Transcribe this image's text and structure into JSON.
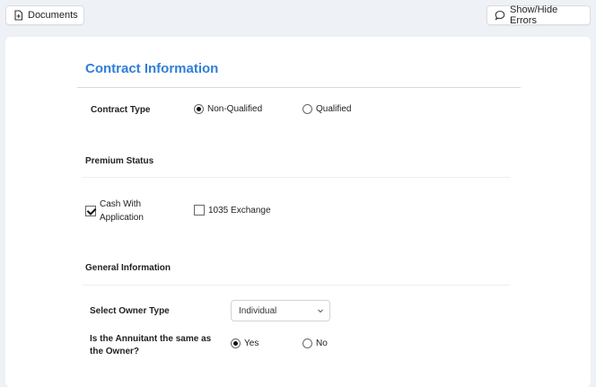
{
  "toolbar": {
    "documents_label": "Documents",
    "errors_label": "Show/Hide Errors"
  },
  "contract": {
    "section_title": "Contract Information",
    "contract_type_label": "Contract Type",
    "options": [
      "Non-Qualified",
      "Qualified"
    ],
    "selected": "Non-Qualified"
  },
  "premium": {
    "title": "Premium Status",
    "cash_line1": "Cash With",
    "cash_line2": "Application",
    "cash_checked": true,
    "exchange_label": "1035 Exchange",
    "exchange_checked": false
  },
  "general": {
    "title": "General Information",
    "owner_type_label": "Select Owner Type",
    "owner_type_value": "Individual",
    "annuitant_line1": "Is the Annuitant the same as",
    "annuitant_line2": "the Owner?",
    "yes_label": "Yes",
    "no_label": "No",
    "annuitant_selected": "Yes"
  }
}
